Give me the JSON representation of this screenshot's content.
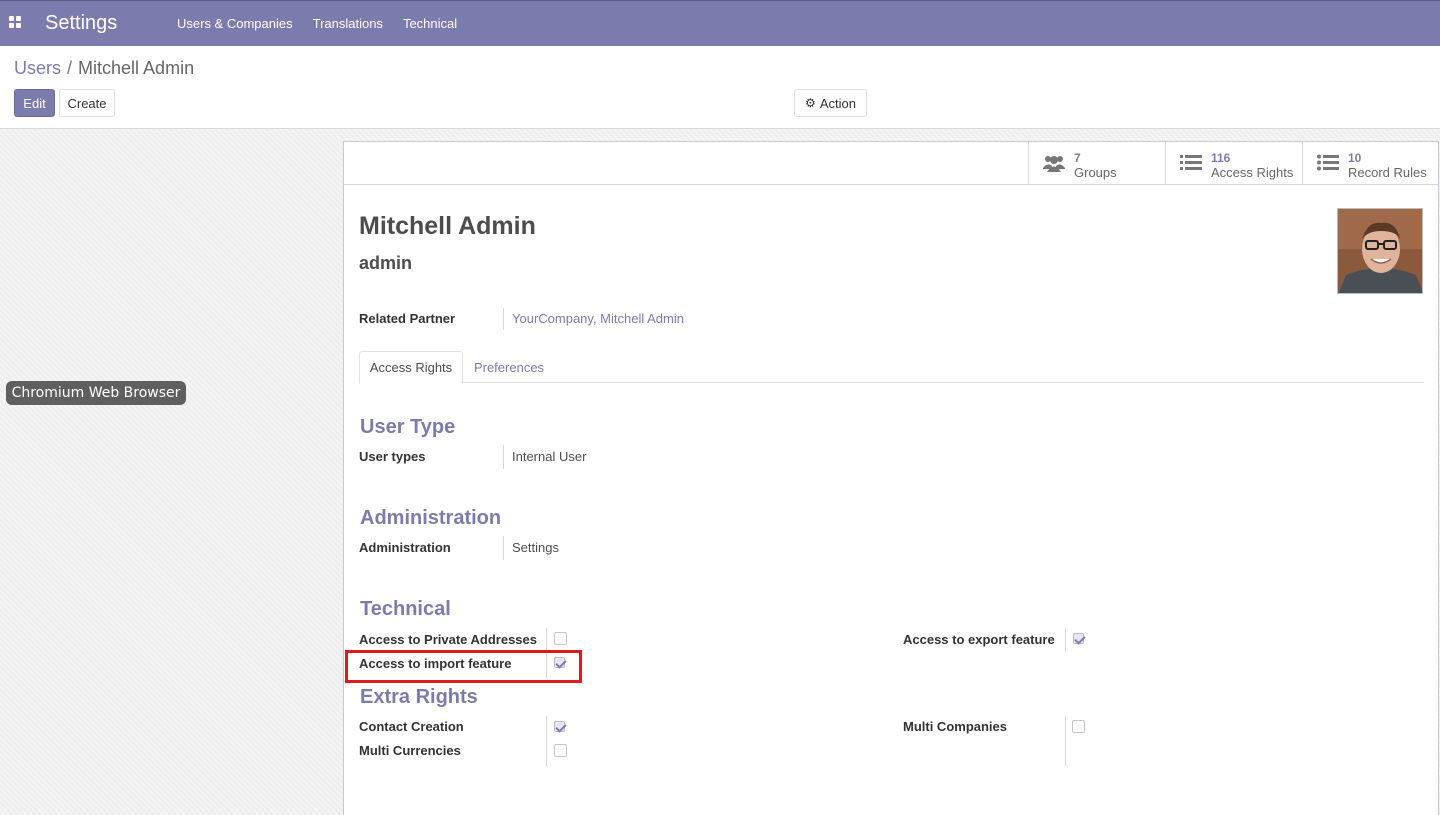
{
  "navbar": {
    "brand": "Settings",
    "menu": [
      "Users & Companies",
      "Translations",
      "Technical"
    ],
    "color": "#7c7bad"
  },
  "breadcrumb": {
    "parent": "Users",
    "separator": "/",
    "current": "Mitchell Admin"
  },
  "control": {
    "edit_label": "Edit",
    "create_label": "Create",
    "action_label": "Action"
  },
  "tooltip": "Chromium Web Browser",
  "stats": [
    {
      "count": "7",
      "label": "Groups",
      "icon": "users-icon"
    },
    {
      "count": "116",
      "label": "Access Rights",
      "icon": "list-icon"
    },
    {
      "count": "10",
      "label": "Record Rules",
      "icon": "list-bullets-icon"
    }
  ],
  "user": {
    "name": "Mitchell Admin",
    "login": "admin"
  },
  "related_partner": {
    "label": "Related Partner",
    "value": "YourCompany, Mitchell Admin"
  },
  "tabs": {
    "access_rights": "Access Rights",
    "preferences": "Preferences"
  },
  "user_type": {
    "section": "User Type",
    "label": "User types",
    "value": "Internal User"
  },
  "administration": {
    "section": "Administration",
    "label": "Administration",
    "value": "Settings"
  },
  "technical": {
    "section": "Technical",
    "private_addresses": {
      "label": "Access to Private Addresses",
      "checked": false
    },
    "import_feature": {
      "label": "Access to import feature",
      "checked": true
    },
    "export_feature": {
      "label": "Access to export feature",
      "checked": true
    }
  },
  "extra_rights": {
    "section": "Extra Rights",
    "contact_creation": {
      "label": "Contact Creation",
      "checked": true
    },
    "multi_currencies": {
      "label": "Multi Currencies",
      "checked": false
    },
    "multi_companies": {
      "label": "Multi Companies",
      "checked": false
    }
  },
  "highlight_color": "#e01a1a"
}
